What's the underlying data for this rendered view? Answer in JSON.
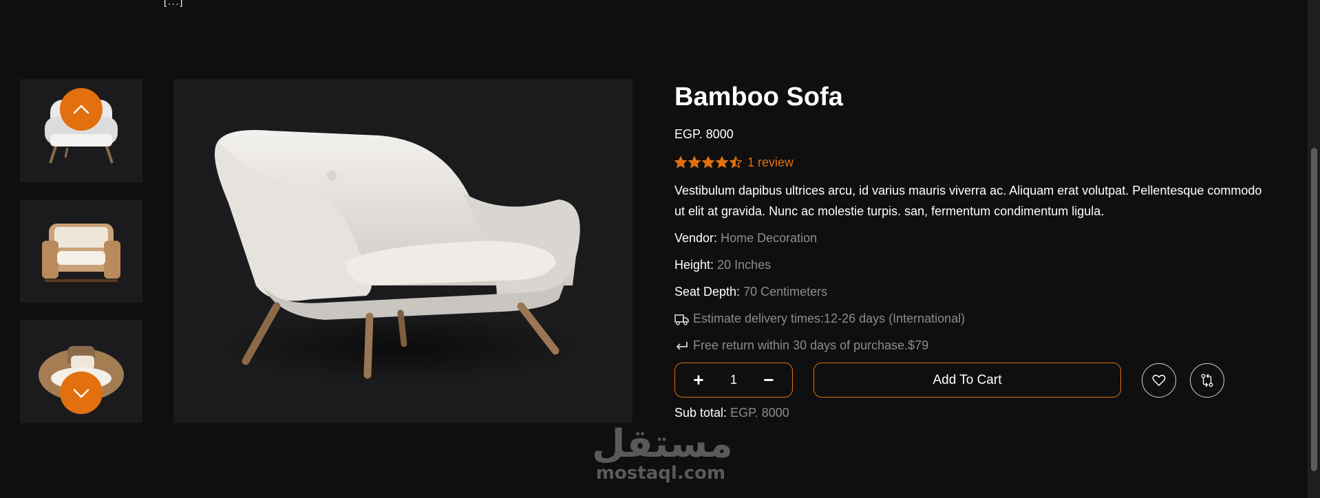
{
  "top_fragment": "[...]",
  "product": {
    "title": "Bamboo Sofa",
    "price": "EGP. 8000",
    "rating_value": 4.5,
    "rating_max": 5,
    "review_text": "1 review",
    "description": "Vestibulum dapibus ultrices arcu, id varius mauris viverra ac. Aliquam erat volutpat. Pellentesque commodo ut elit at gravida. Nunc ac molestie turpis. san, fermentum condimentum ligula.",
    "specs": [
      {
        "label": "Vendor:",
        "value": "Home Decoration"
      },
      {
        "label": "Height:",
        "value": "20 Inches"
      },
      {
        "label": "Seat Depth:",
        "value": "70 Centimeters"
      }
    ],
    "delivery_text": "Estimate delivery times:12-26 days (International)",
    "return_text": "Free return within 30 days of purchase.$79",
    "quantity": "1",
    "add_to_cart_label": "Add To Cart",
    "subtotal_label": "Sub total:",
    "subtotal_value": "EGP. 8000"
  },
  "icons": {
    "nav_up": "chevron-up-icon",
    "nav_down": "chevron-down-icon",
    "plus": "+",
    "minus": "−",
    "wishlist": "heart-icon",
    "compare": "compare-icon",
    "delivery": "truck-icon",
    "return": "return-arrow-icon"
  },
  "colors": {
    "background": "#0f0f0f",
    "card": "#1b1b1d",
    "accent": "#e2700f",
    "muted": "#8c8c8c"
  },
  "watermark": {
    "arabic": "مستقل",
    "latin": "mostaql.com"
  }
}
